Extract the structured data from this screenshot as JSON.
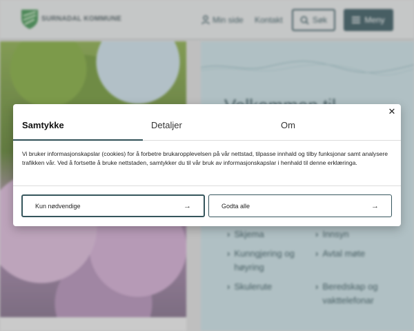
{
  "header": {
    "brand": "SURNADAL KOMMUNE",
    "min_side": "Min side",
    "kontakt": "Kontakt",
    "sok": "Søk",
    "meny": "Meny"
  },
  "hero": {
    "welcome": "Velkommen til"
  },
  "links": [
    {
      "label": "Skjema"
    },
    {
      "label": "Innsyn"
    },
    {
      "label": "Kunngjering og høyring"
    },
    {
      "label": "Avtal møte"
    },
    {
      "label": "Skulerute"
    },
    {
      "label": "Beredskap og vakttelefonar"
    }
  ],
  "dialog": {
    "close": "✕",
    "tabs": [
      "Samtykke",
      "Detaljer",
      "Om"
    ],
    "text": "Vi bruker informasjonskapslar (cookies) for å forbetre brukaropplevelsen på vår nettstad, tilpasse innhald og tilby funksjonar samt analysere trafikken vår. Ved å fortsette å bruke nettstaden, samtykker du til vår bruk av informasjonskapslar i henhald til denne erklæringa.",
    "button_necessary": "Kun nødvendige",
    "button_accept": "Godta alle",
    "arrow": "→"
  },
  "colors": {
    "accent": "#35555c",
    "panel": "#c7dde2"
  }
}
